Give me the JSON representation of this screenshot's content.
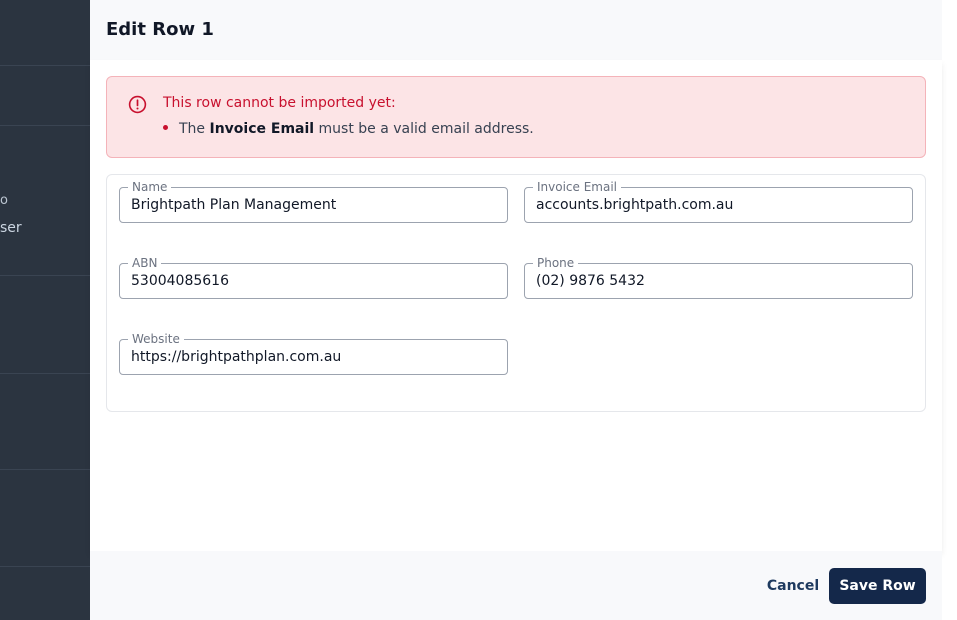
{
  "backdrop": {
    "fragment_1": "o",
    "fragment_2": "ser"
  },
  "dialog": {
    "title": "Edit Row 1"
  },
  "alert": {
    "heading": "This row cannot be imported yet:",
    "error_prefix": "The ",
    "error_field": "Invoice Email",
    "error_suffix": " must be a valid email address.",
    "icon": "alert-circle-icon",
    "color": "#c8102e"
  },
  "form": {
    "name": {
      "label": "Name",
      "value": "Brightpath Plan Management"
    },
    "invoice_email": {
      "label": "Invoice Email",
      "value": "accounts.brightpath.com.au"
    },
    "abn": {
      "label": "ABN",
      "value": "53004085616"
    },
    "phone": {
      "label": "Phone",
      "value": "(02) 9876 5432"
    },
    "website": {
      "label": "Website",
      "value": "https://brightpathplan.com.au"
    }
  },
  "footer": {
    "cancel_label": "Cancel",
    "save_label": "Save Row",
    "primary_color": "#14284a"
  }
}
